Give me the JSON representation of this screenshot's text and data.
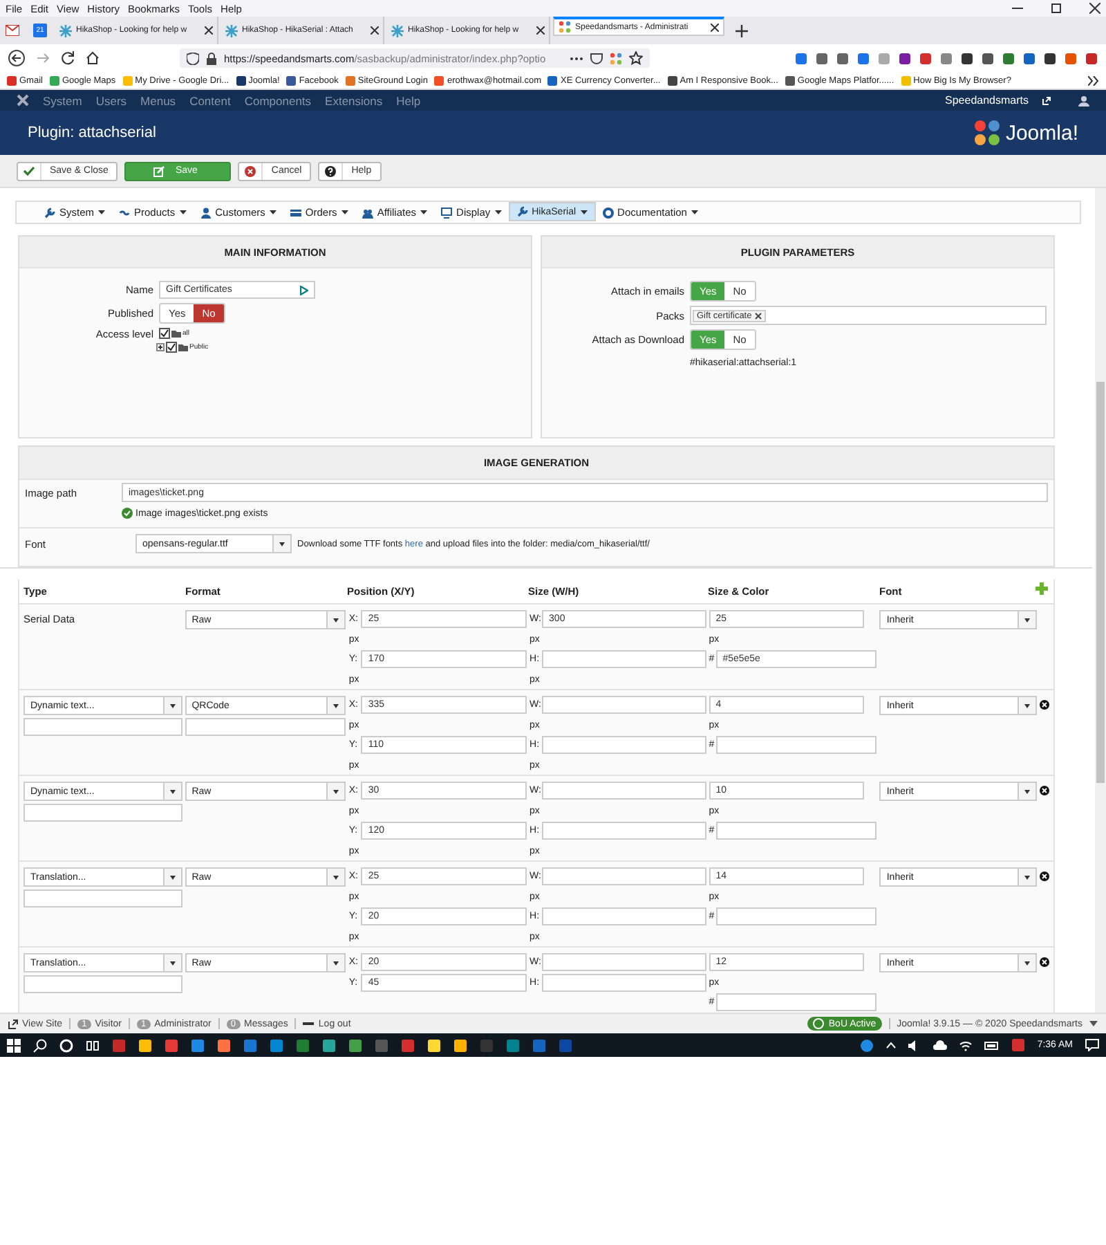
{
  "browser": {
    "menu": [
      "File",
      "Edit",
      "View",
      "History",
      "Bookmarks",
      "Tools",
      "Help"
    ],
    "calendar_day": "21",
    "tabs": [
      {
        "label": "HikaShop - Looking for help w",
        "selected": false
      },
      {
        "label": "HikaShop - HikaSerial : Attach",
        "selected": false
      },
      {
        "label": "HikaShop - Looking for help w",
        "selected": false
      },
      {
        "label": "Speedandsmarts - Administrati",
        "selected": true
      }
    ],
    "url_host": "https://speedandsmarts.com",
    "url_path": "/sasbackup/administrator/index.php?optio",
    "bookmarks": [
      "Gmail",
      "Google Maps",
      "My Drive - Google Dri...",
      "Joomla!",
      "Facebook",
      "SiteGround Login",
      "erothwax@hotmail.com",
      "XE Currency Converter...",
      "Am I Responsive Book...",
      "Google Maps Platfor......",
      "How Big Is My Browser?"
    ]
  },
  "admin_menu": {
    "items": [
      "System",
      "Users",
      "Menus",
      "Content",
      "Components",
      "Extensions",
      "Help"
    ],
    "site": "Speedandsmarts"
  },
  "page_title": "Plugin: attachserial",
  "logo_text": "Joomla!",
  "toolbar": [
    {
      "kind": "check",
      "label": "Save & Close"
    },
    {
      "kind": "save",
      "label": "Save"
    },
    {
      "kind": "cancel",
      "label": "Cancel"
    },
    {
      "kind": "help",
      "label": "Help"
    }
  ],
  "submenu": [
    {
      "kind": "wrench",
      "label": "System",
      "selected": false
    },
    {
      "kind": "link",
      "label": "Products",
      "selected": false
    },
    {
      "kind": "user",
      "label": "Customers",
      "selected": false
    },
    {
      "kind": "card",
      "label": "Orders",
      "selected": false
    },
    {
      "kind": "users",
      "label": "Affiliates",
      "selected": false
    },
    {
      "kind": "monitor",
      "label": "Display",
      "selected": false
    },
    {
      "kind": "wrench",
      "label": "HikaSerial",
      "selected": true
    },
    {
      "kind": "lifebuoy",
      "label": "Documentation",
      "selected": false
    }
  ],
  "main_information": {
    "title": "MAIN INFORMATION",
    "name_label": "Name",
    "name_value": "Gift Certificates",
    "published_label": "Published",
    "published": [
      {
        "kind": "yes",
        "label": "Yes",
        "selected": false
      },
      {
        "kind": "no",
        "label": "No",
        "selected": true
      }
    ],
    "access_label": "Access level",
    "access_tree": [
      {
        "label": "all",
        "checked": true,
        "children": [
          {
            "label": "Public",
            "checked": true
          }
        ]
      }
    ]
  },
  "plugin_parameters": {
    "title": "PLUGIN PARAMETERS",
    "emails_label": "Attach in emails",
    "emails": [
      {
        "kind": "yes",
        "label": "Yes",
        "selected": true
      },
      {
        "kind": "no",
        "label": "No",
        "selected": false
      }
    ],
    "packs_label": "Packs",
    "packs": [
      "Gift certificate"
    ],
    "download_label": "Attach as Download",
    "download": [
      {
        "kind": "yes",
        "label": "Yes",
        "selected": true
      },
      {
        "kind": "no",
        "label": "No",
        "selected": false
      }
    ],
    "tag": "#hikaserial:attachserial:1"
  },
  "image_generation": {
    "title": "IMAGE GENERATION",
    "path_label": "Image path",
    "path_value": "images\\ticket.png",
    "status": "Image images\\ticket.png exists",
    "font_label": "Font",
    "font_value": "opensans-regular.ttf",
    "help_before": "Download some TTF fonts",
    "help_link": "here",
    "help_after": "and upload files into the folder: media/com_hikaserial/ttf/"
  },
  "table": {
    "columns": [
      "Type",
      "Format",
      "Position (X/Y)",
      "Size (W/H)",
      "Size & Color",
      "Font"
    ],
    "rows": [
      {
        "kind": "text",
        "type": "Serial Data",
        "format": "Raw",
        "format_field": false,
        "position": [
          {
            "axis": "X:",
            "value": "25",
            "unit": "px"
          },
          {
            "axis": "Y:",
            "value": "170",
            "unit": "px"
          }
        ],
        "size": [
          {
            "axis": "W:",
            "value": "300",
            "unit": "px"
          },
          {
            "axis": "H:",
            "unit": "px"
          }
        ],
        "text_size": "25",
        "size_unit": "px",
        "hash": "#",
        "color_code": "#5e5e5e",
        "font": "Inherit",
        "removable": false
      },
      {
        "kind": "select",
        "type": "Dynamic text...",
        "format": "QRCode",
        "format_field": true,
        "position": [
          {
            "axis": "X:",
            "value": "335",
            "unit": "px"
          },
          {
            "axis": "Y:",
            "value": "110",
            "unit": "px"
          }
        ],
        "size": [
          {
            "axis": "W:",
            "unit": "px"
          },
          {
            "axis": "H:",
            "unit": "px"
          }
        ],
        "text_size": "4",
        "size_unit": "px",
        "hash": "#",
        "font": "Inherit",
        "removable": true
      },
      {
        "kind": "select",
        "type": "Dynamic text...",
        "format": "Raw",
        "format_field": false,
        "position": [
          {
            "axis": "X:",
            "value": "30",
            "unit": "px"
          },
          {
            "axis": "Y:",
            "value": "120",
            "unit": "px"
          }
        ],
        "size": [
          {
            "axis": "W:",
            "unit": "px"
          },
          {
            "axis": "H:",
            "unit": "px"
          }
        ],
        "text_size": "10",
        "size_unit": "px",
        "hash": "#",
        "font": "Inherit",
        "removable": true
      },
      {
        "kind": "select",
        "type": "Translation...",
        "format": "Raw",
        "format_field": false,
        "position": [
          {
            "axis": "X:",
            "value": "25",
            "unit": "px"
          },
          {
            "axis": "Y:",
            "value": "20",
            "unit": "px"
          }
        ],
        "size": [
          {
            "axis": "W:",
            "unit": "px"
          },
          {
            "axis": "H:",
            "unit": "px"
          }
        ],
        "text_size": "14",
        "size_unit": "px",
        "hash": "#",
        "font": "Inherit",
        "removable": true
      },
      {
        "kind": "select",
        "type": "Translation...",
        "format": "Raw",
        "format_field": false,
        "position": [
          {
            "axis": "X:",
            "value": "20"
          },
          {
            "axis": "Y:",
            "value": "45"
          }
        ],
        "size": [
          {
            "axis": "W:"
          },
          {
            "axis": "H:"
          }
        ],
        "text_size": "12",
        "size_unit": "px",
        "hash": "#",
        "font": "Inherit",
        "removable": true
      }
    ]
  },
  "status_bar": {
    "items": [
      {
        "kind": "link",
        "label": "View Site"
      },
      {
        "kind": "count",
        "count": "1",
        "label": "Visitor"
      },
      {
        "kind": "count",
        "count": "1",
        "label": "Administrator"
      },
      {
        "kind": "count",
        "count": "0",
        "label": "Messages"
      },
      {
        "kind": "logout",
        "label": "Log out"
      }
    ],
    "badge": "BoU Active",
    "version": "Joomla! 3.9.15",
    "dash": "—",
    "copyright": "© 2020 Speedandsmarts"
  },
  "taskbar": {
    "time": "7:36 AM"
  }
}
